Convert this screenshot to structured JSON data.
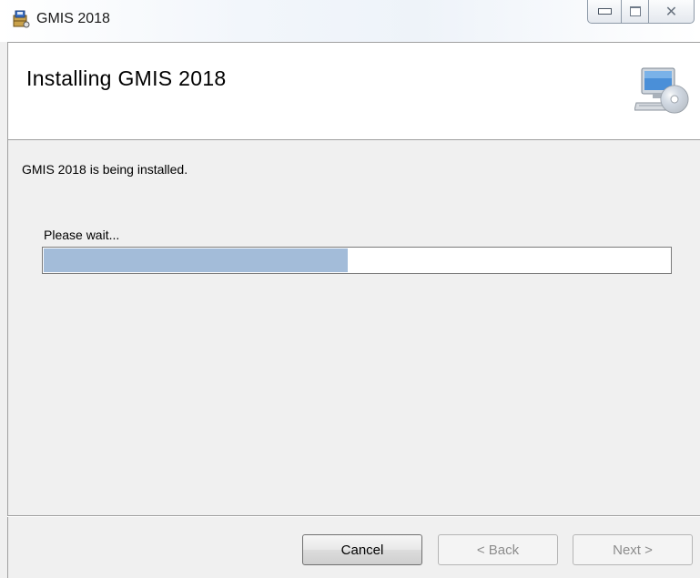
{
  "window": {
    "title": "GMIS 2018",
    "caption_buttons": {
      "minimize_icon": "minimize-icon",
      "maximize_icon": "maximize-icon",
      "close_icon": "close-icon"
    }
  },
  "header": {
    "title": "Installing GMIS 2018",
    "icon": "computer-cd-icon"
  },
  "body": {
    "status": "GMIS 2018 is being installed.",
    "wait_label": "Please wait..."
  },
  "progress": {
    "fraction": 0.485,
    "color": "#a3bcd9"
  },
  "buttons": {
    "cancel": "Cancel",
    "back": "< Back",
    "next": "Next >"
  }
}
